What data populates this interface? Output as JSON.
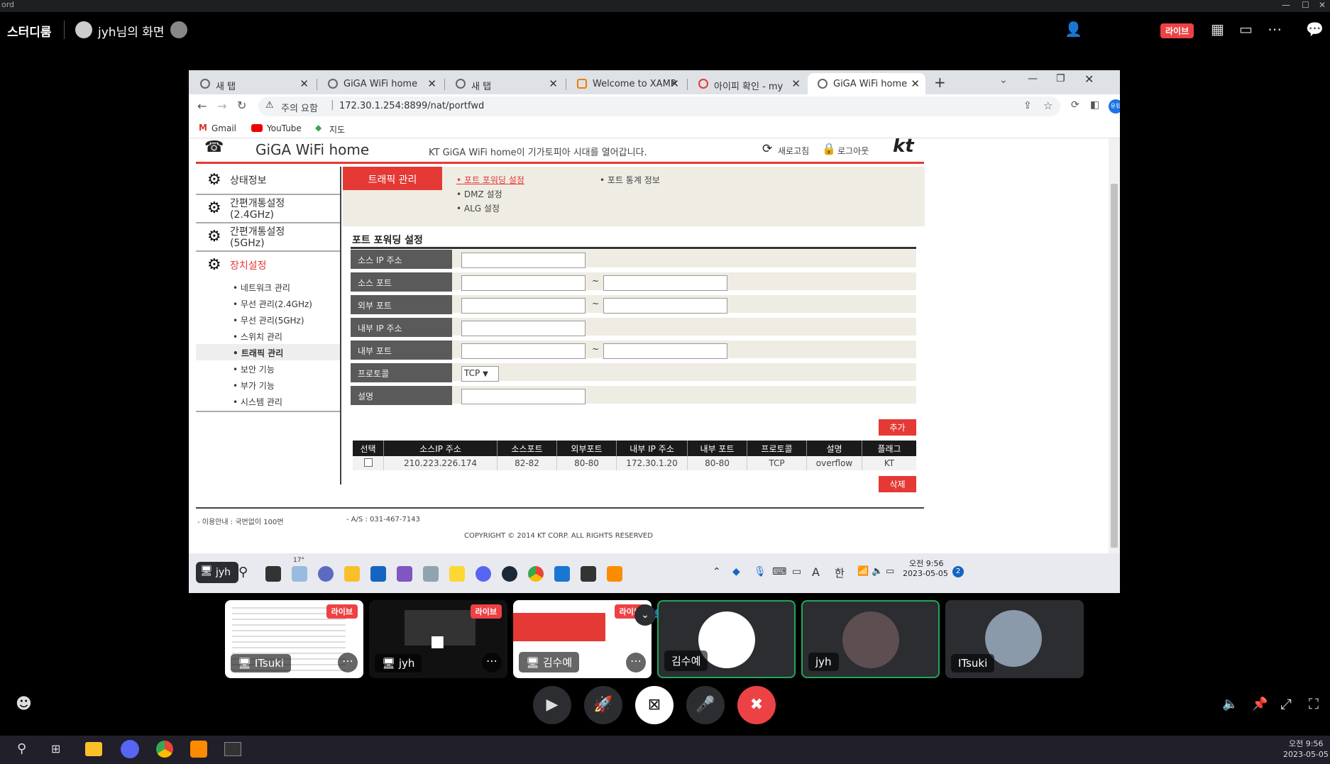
{
  "app_title": "ord",
  "call": {
    "room_name": "스터디룸",
    "screen_owner": "jyh님의 화면",
    "live_label": "라이브"
  },
  "browser": {
    "tabs": [
      {
        "title": "새 탭"
      },
      {
        "title": "GiGA WiFi home"
      },
      {
        "title": "새 탭"
      },
      {
        "title": "Welcome to XAMP"
      },
      {
        "title": "아이피 확인 - my"
      },
      {
        "title": "GiGA WiFi home"
      }
    ],
    "security_label": "주의 요함",
    "url": "172.30.1.254:8899/nat/portfwd",
    "profile_label": "유튜",
    "bookmarks": [
      "Gmail",
      "YouTube",
      "지도"
    ]
  },
  "router": {
    "brand": "GiGA WiFi home",
    "tagline": "KT GiGA WiFi home이 기가토피아 시대를 열어갑니다.",
    "refresh": "새로고침",
    "logout": "로그아웃",
    "logo": "kt",
    "sidebar": [
      {
        "label": "상태정보"
      },
      {
        "label": "간편개통설정",
        "sub": "(2.4GHz)"
      },
      {
        "label": "간편개통설정",
        "sub": "(5GHz)"
      },
      {
        "label": "장치설정"
      }
    ],
    "subitems": [
      "네트워크 관리",
      "무선 관리(2.4GHz)",
      "무선 관리(5GHz)",
      "스위치 관리",
      "트래픽 관리",
      "보안 기능",
      "부가 기능",
      "시스템 관리"
    ],
    "section_tab": "트래픽 관리",
    "links": [
      "포트 포워딩 설정",
      "DMZ 설정",
      "ALG 설정",
      "포트 통계 정보"
    ],
    "form_title": "포트 포워딩 설정",
    "form": {
      "src_ip": "소스 IP 주소",
      "src_port": "소스 포트",
      "ext_port": "외부 포트",
      "int_ip": "내부 IP 주소",
      "int_port": "내부 포트",
      "protocol": "프로토콜",
      "desc": "설명",
      "tilde": "~",
      "protocol_value": "TCP"
    },
    "add_btn": "추가",
    "delete_btn": "삭제",
    "table_headers": [
      "선택",
      "소스IP 주소",
      "소스포트",
      "외부포트",
      "내부 IP 주소",
      "내부 포트",
      "프로토콜",
      "설명",
      "플래그"
    ],
    "table_row": [
      "210.223.226.174",
      "82-82",
      "80-80",
      "172.30.1.20",
      "80-80",
      "TCP",
      "overflow",
      "KT"
    ],
    "footer_left": "- 이용안내 : 국번없이 100번",
    "footer_mid": "- A/S : 031-467-7143",
    "copyright": "COPYRIGHT © 2014 KT CORP. ALL RIGHTS RESERVED"
  },
  "remote_taskbar": {
    "stream_label": "jyh",
    "weather": "17°",
    "ime": "한",
    "font_icon": "A",
    "time": "오전 9:56",
    "date": "2023-05-05",
    "badge": "2"
  },
  "tiles": [
    {
      "name": "ITsuki",
      "live": "라이브"
    },
    {
      "name": "jyh",
      "live": "라이브"
    },
    {
      "name": "김수예",
      "live": "라이브"
    },
    {
      "name": "김수예"
    },
    {
      "name": "jyh"
    },
    {
      "name": "ITsuki"
    }
  ],
  "taskbar": {
    "time": "오전 9:56",
    "date": "2023-05-05"
  }
}
